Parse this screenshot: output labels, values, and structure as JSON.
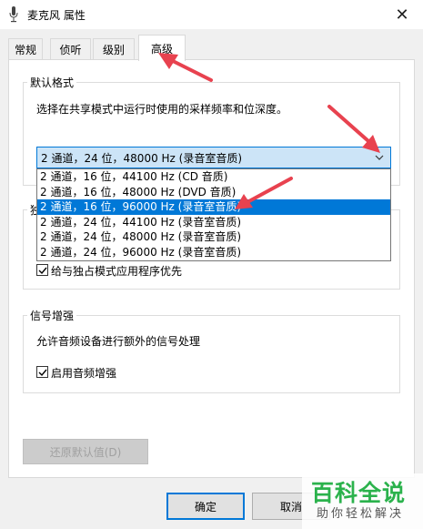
{
  "window": {
    "title": "麦克风 属性",
    "close_glyph": "✕"
  },
  "tabs": [
    "常规",
    "侦听",
    "级别",
    "高级"
  ],
  "default_format": {
    "group_title": "默认格式",
    "description": "选择在共享模式中运行时使用的采样频率和位深度。",
    "selected": "2 通道，24 位，48000 Hz (录音室音质)",
    "options": [
      "2 通道，16 位，44100 Hz (CD 音质)",
      "2 通道，16 位，48000 Hz (DVD 音质)",
      "2 通道，16 位，96000 Hz (录音室音质)",
      "2 通道，24 位，44100 Hz (录音室音质)",
      "2 通道，24 位，48000 Hz (录音室音质)",
      "2 通道，24 位，96000 Hz (录音室音质)"
    ],
    "highlighted_index": 2
  },
  "exclusive": {
    "group_title_partial": "独",
    "priority_label": "给与独占模式应用程序优先",
    "priority_checked": true
  },
  "signal": {
    "group_title": "信号增强",
    "description": "允许音频设备进行额外的信号处理",
    "enable_label": "启用音频增强",
    "enable_checked": true
  },
  "buttons": {
    "restore_defaults": "还原默认值(D)",
    "ok": "确定",
    "cancel": "取消"
  },
  "watermark": {
    "main": "百科全说",
    "sub": "助你轻松解决"
  },
  "colors": {
    "accent": "#0078d7",
    "annotation": "#e8424f",
    "watermark": "#2bb24c"
  }
}
